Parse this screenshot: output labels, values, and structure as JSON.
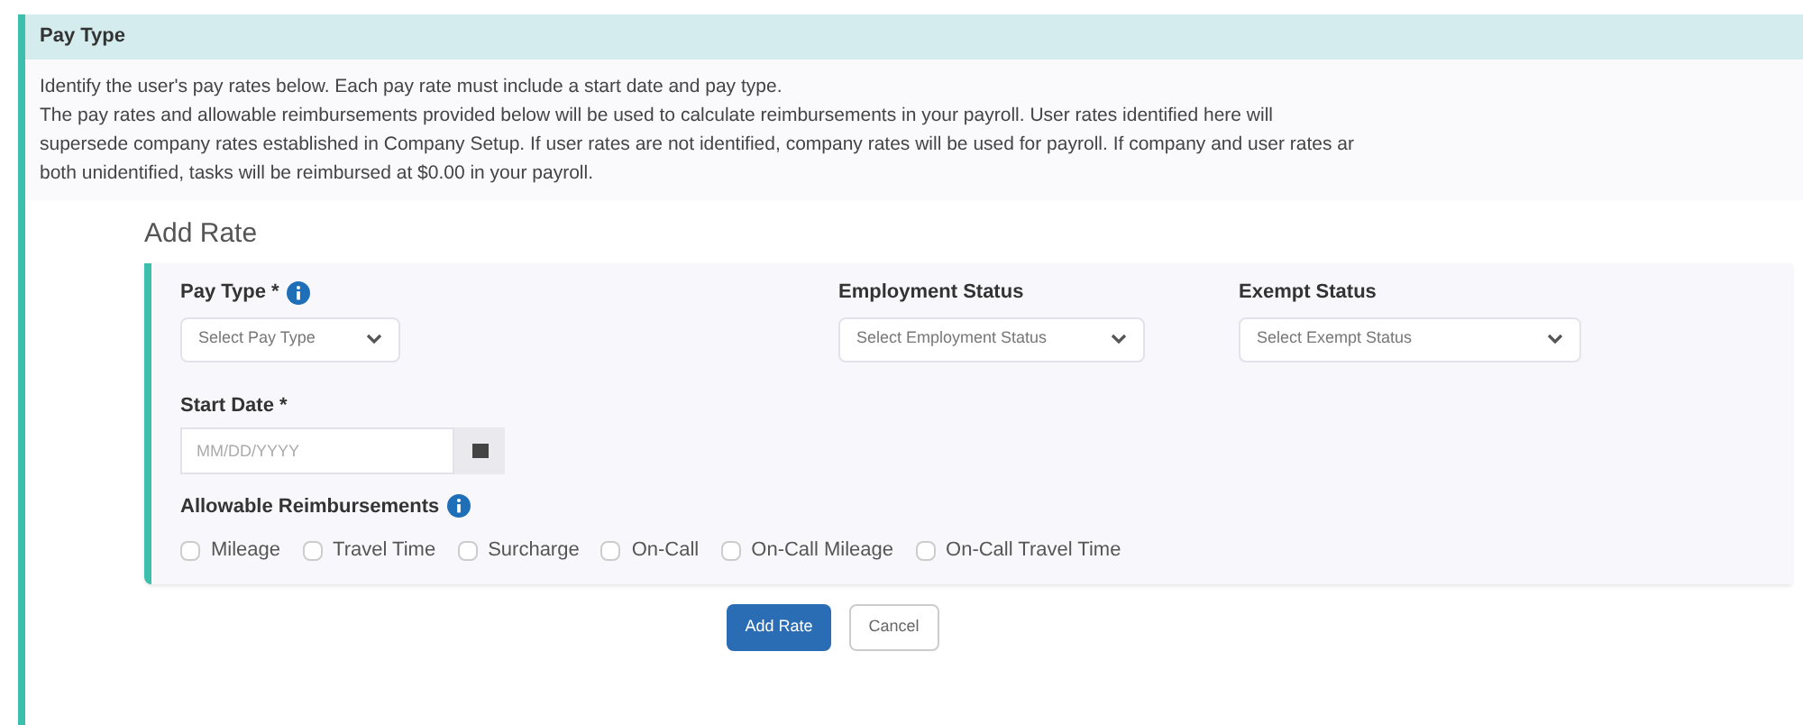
{
  "section": {
    "title": "Pay Type",
    "description_lines": [
      "Identify the user's pay rates below. Each pay rate must include a start date and pay type.",
      "The pay rates and allowable reimbursements provided below will be used to calculate reimbursements in your payroll. User rates identified here will",
      "supersede company rates established in Company Setup. If user rates are not identified, company rates will be used for payroll. If company and user rates ar",
      "both unidentified, tasks will be reimbursed at $0.00 in your payroll."
    ]
  },
  "add_rate": {
    "title": "Add Rate",
    "selects": [
      {
        "label": "Pay Type *",
        "info": true,
        "placeholder": "Select Pay Type"
      },
      {
        "label": "Employment Status",
        "info": false,
        "placeholder": "Select Employment Status"
      },
      {
        "label": "Exempt Status",
        "info": false,
        "placeholder": "Select Exempt Status"
      }
    ],
    "start_date": {
      "label": "Start Date *",
      "placeholder": "MM/DD/YYYY"
    },
    "reimbursements": {
      "label": "Allowable Reimbursements",
      "options": [
        {
          "label": "Mileage",
          "checked": false
        },
        {
          "label": "Travel Time",
          "checked": false
        },
        {
          "label": "Surcharge",
          "checked": false
        },
        {
          "label": "On-Call",
          "checked": false
        },
        {
          "label": "On-Call Mileage",
          "checked": false
        },
        {
          "label": "On-Call Travel Time",
          "checked": false
        }
      ]
    }
  },
  "buttons": [
    {
      "label": "Add Rate",
      "kind": "primary"
    },
    {
      "label": "Cancel",
      "kind": "secondary"
    }
  ]
}
